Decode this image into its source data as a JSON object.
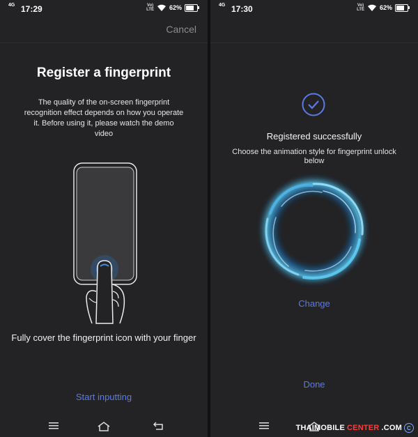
{
  "left": {
    "status": {
      "network": "4G",
      "time": "17:29",
      "volte": "Vo)\nLTE",
      "battery": "62%"
    },
    "cancel_label": "Cancel",
    "title": "Register a fingerprint",
    "description": "The quality of the on-screen fingerprint recognition effect depends on how you operate it. Before using it, please watch the demo video",
    "hint": "Fully cover the fingerprint icon with your finger",
    "start_label": "Start inputting"
  },
  "right": {
    "status": {
      "network": "4G",
      "time": "17:30",
      "volte": "Vo)\nLTE",
      "battery": "62%"
    },
    "registered_text": "Registered successfully",
    "choose_text": "Choose the animation style for fingerprint unlock below",
    "change_label": "Change",
    "done_label": "Done"
  },
  "watermark": {
    "part1": "THAIMOBILE",
    "part2": "CENTER",
    "part3": ".COM",
    "symbol": "C"
  },
  "icons": {
    "menu": "menu-icon",
    "home": "home-icon",
    "back": "back-icon",
    "wifi": "wifi-icon",
    "check": "check-circle-icon",
    "ring": "fingerprint-animation-ring"
  },
  "colors": {
    "accent": "#5a7be3",
    "background": "#232325",
    "ring_glow": "#5fd4ff"
  }
}
